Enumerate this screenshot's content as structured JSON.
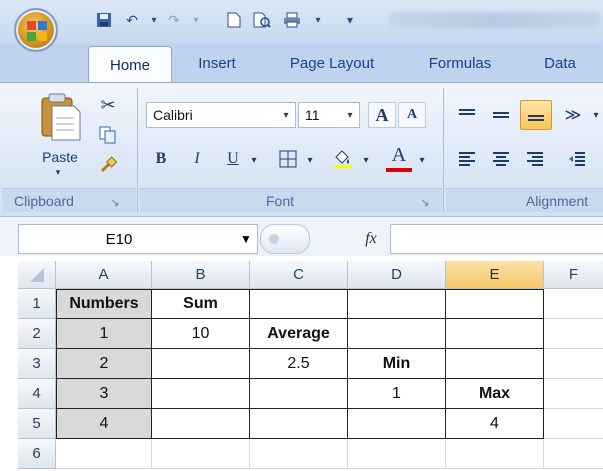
{
  "window": {
    "qat_icons": [
      "save-icon",
      "undo-icon",
      "redo-icon",
      "new-icon",
      "print-preview-icon",
      "print-icon"
    ],
    "office_logo_colors": [
      "#e24a2b",
      "#2f7ad6",
      "#4aa53a",
      "#f5b21b"
    ]
  },
  "tabs": [
    {
      "label": "Home",
      "active": true
    },
    {
      "label": "Insert"
    },
    {
      "label": "Page Layout"
    },
    {
      "label": "Formulas"
    },
    {
      "label": "Data"
    }
  ],
  "ribbon": {
    "clipboard": {
      "label": "Clipboard",
      "paste_label": "Paste",
      "launcher_glyph": "↘"
    },
    "font": {
      "label": "Font",
      "font_name": "Calibri",
      "font_size": "11",
      "grow_label": "A",
      "shrink_label": "A",
      "bold_label": "B",
      "italic_label": "I",
      "underline_label": "U",
      "font_color_label": "A",
      "font_color": "#e00000",
      "launcher_glyph": "↘"
    },
    "alignment": {
      "label": "Alignment"
    }
  },
  "formula_bar": {
    "name_box": "E10",
    "fx_label": "fx",
    "value": ""
  },
  "sheet": {
    "columns": [
      "A",
      "B",
      "C",
      "D",
      "E",
      "F"
    ],
    "rows": [
      "1",
      "2",
      "3",
      "4",
      "5",
      "6"
    ],
    "selected_column": "E",
    "cells": {
      "A1": "Numbers",
      "B1": "Sum",
      "A2": "1",
      "B2": "10",
      "C2": "Average",
      "A3": "2",
      "C3": "2.5",
      "D3": "Min",
      "A4": "3",
      "D4": "1",
      "E4": "Max",
      "A5": "4",
      "E5": "4"
    }
  }
}
